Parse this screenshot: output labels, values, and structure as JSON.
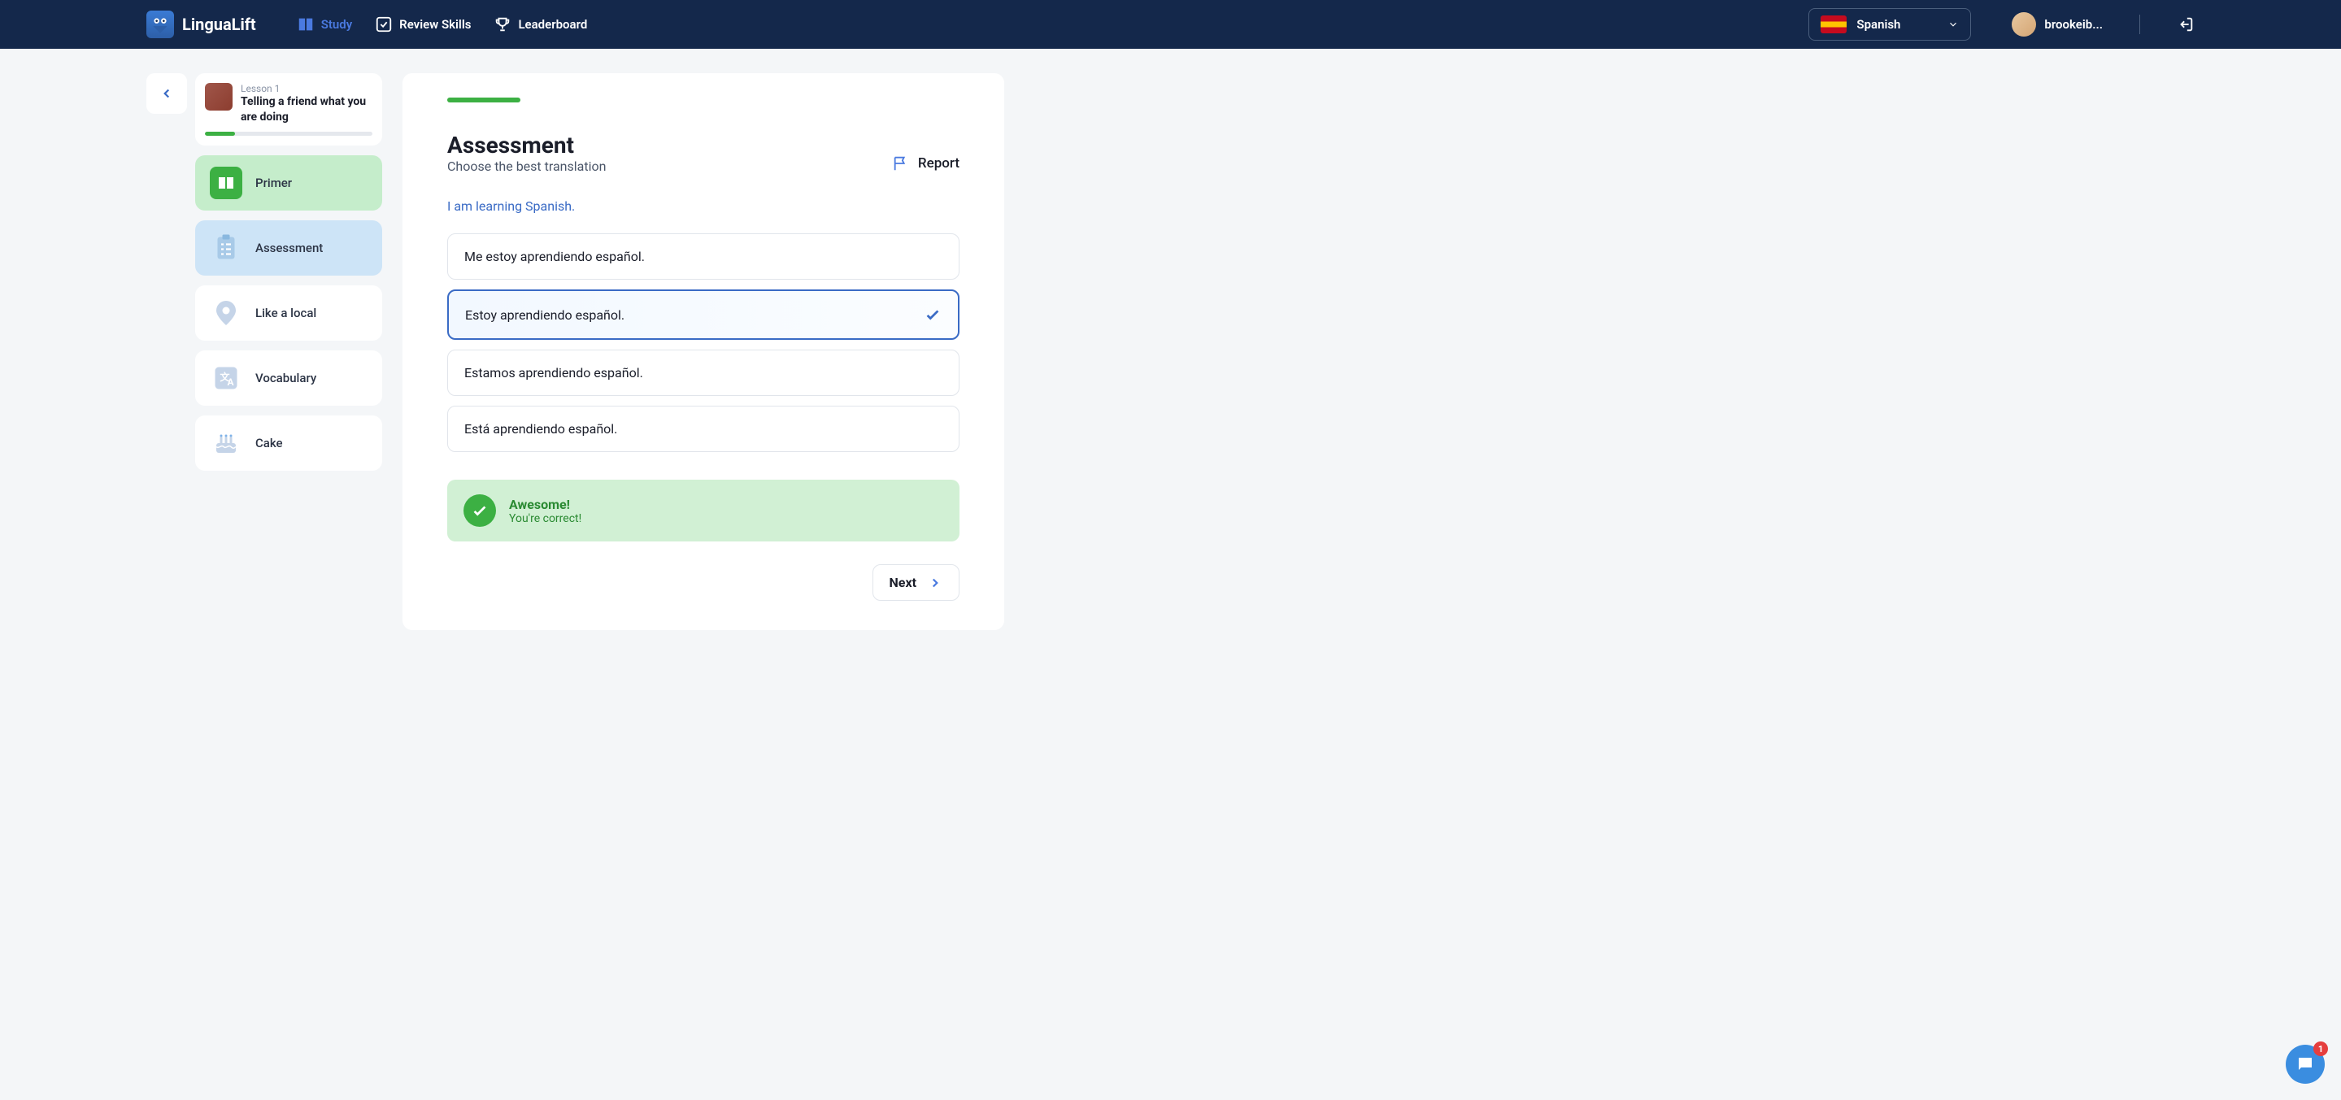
{
  "header": {
    "brand": "LinguaLift",
    "nav": {
      "study": "Study",
      "review": "Review Skills",
      "leaderboard": "Leaderboard"
    },
    "language": "Spanish",
    "username": "brookeib..."
  },
  "sidebar": {
    "lesson": {
      "num": "Lesson 1",
      "title": "Telling a friend what you are doing",
      "progress_pct": 18
    },
    "steps": {
      "primer": "Primer",
      "assessment": "Assessment",
      "local": "Like a local",
      "vocab": "Vocabulary",
      "cake": "Cake"
    }
  },
  "main": {
    "title": "Assessment",
    "subtitle": "Choose the best translation",
    "report": "Report",
    "prompt": "I am learning Spanish.",
    "options": [
      "Me estoy aprendiendo español.",
      "Estoy aprendiendo español.",
      "Estamos aprendiendo español.",
      "Está aprendiendo español."
    ],
    "correct_index": 1,
    "feedback": {
      "title": "Awesome!",
      "sub": "You're correct!"
    },
    "next": "Next"
  },
  "chat_badge": "1"
}
